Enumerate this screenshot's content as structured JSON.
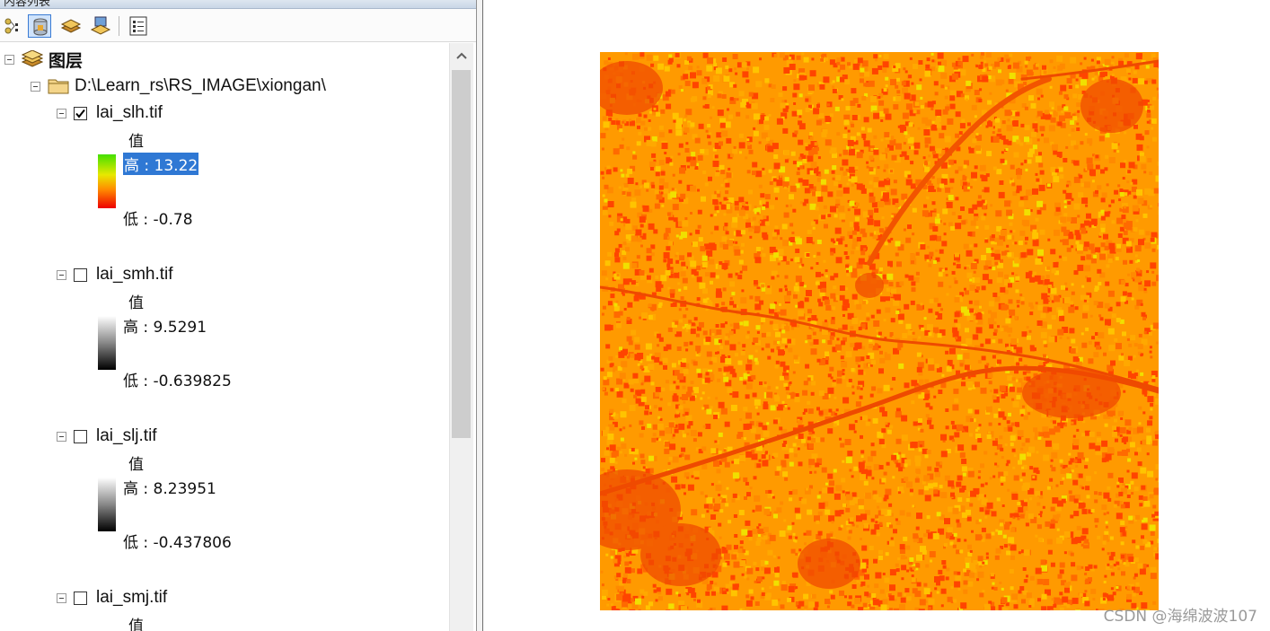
{
  "toc": {
    "title": "内容列表",
    "toolbar": [
      {
        "icon": "list-by-drawing-order-icon"
      },
      {
        "icon": "list-by-source-icon",
        "active": true
      },
      {
        "icon": "list-by-visibility-icon"
      },
      {
        "icon": "list-by-selection-icon"
      },
      {
        "icon": "options-icon"
      }
    ],
    "tree": {
      "root_label": "图层",
      "folder_label": "D:\\Learn_rs\\RS_IMAGE\\xiongan\\",
      "layers": [
        {
          "name": "lai_slh.tif",
          "checked": true,
          "field": "值",
          "high": "高 : 13.22",
          "low": "低 : -0.78",
          "ramp": "green-yellow-red"
        },
        {
          "name": "lai_smh.tif",
          "checked": false,
          "field": "值",
          "high": "高 : 9.5291",
          "low": "低 : -0.639825",
          "ramp": "white-black"
        },
        {
          "name": "lai_slj.tif",
          "checked": false,
          "field": "值",
          "high": "高 : 8.23951",
          "low": "低 : -0.437806",
          "ramp": "white-black"
        },
        {
          "name": "lai_smj.tif",
          "checked": false,
          "field": "值"
        }
      ]
    }
  },
  "map": {
    "watermark": "CSDN @海绵波波107",
    "palette": [
      "#ff4400",
      "#ff6a00",
      "#ff8a00",
      "#ffa800",
      "#ffc400",
      "#f0e000"
    ]
  }
}
